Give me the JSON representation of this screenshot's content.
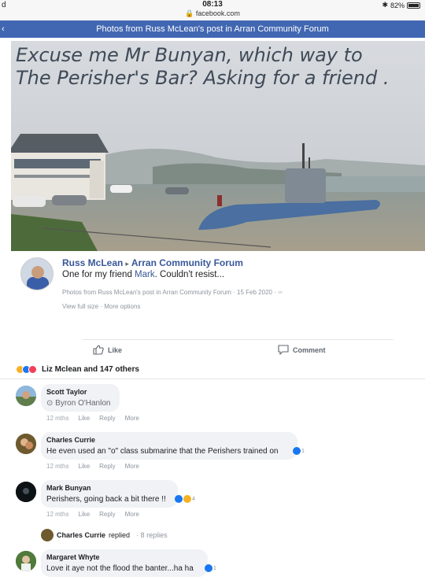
{
  "status_bar": {
    "left": "d",
    "time": "08:13",
    "url": "facebook.com",
    "battery": "82%"
  },
  "header": {
    "back": "‹",
    "title": "Photos from Russ McLean's post in Arran Community Forum"
  },
  "photo": {
    "caption": "Excuse me Mr Bunyan, which way to\nThe Perisher's Bar? Asking for a friend ."
  },
  "post": {
    "author": "Russ McLean",
    "separator": "▸",
    "group": "Arran Community Forum",
    "message_before": "One for my friend ",
    "mention": "Mark",
    "message_after": ". Couldn't resist...",
    "meta": "Photos from Russ McLean's post in Arran Community Forum · 15 Feb 2020 ·",
    "links": "View full size · More options"
  },
  "actions": {
    "like": "Like",
    "comment": "Comment"
  },
  "reactions": {
    "summary": "Liz Mclean and 147 others",
    "colors": [
      "#f7b125",
      "#1877f2",
      "#f33e58"
    ]
  },
  "comments": [
    {
      "name": "Scott Taylor",
      "text": "Byron O'Hanlon",
      "time": "12 mths",
      "like": "Like",
      "reply": "Reply",
      "more": "More",
      "reaction_count": ""
    },
    {
      "name": "Charles Currie",
      "text": "He even used an \"o\" class submarine that the Perishers trained on",
      "time": "12 mths",
      "like": "Like",
      "reply": "Reply",
      "more": "More",
      "reaction_count": "1"
    },
    {
      "name": "Mark Bunyan",
      "text": "Perishers, going back a bit there !!",
      "time": "12 mths",
      "like": "Like",
      "reply": "Reply",
      "more": "More",
      "reaction_count": "4"
    },
    {
      "name": "Margaret Whyte",
      "text": "Love it aye not the flood the banter...ha ha",
      "reaction_count": "1"
    }
  ],
  "reply_thread": {
    "who": "Charles Currie",
    "replied": "replied",
    "count": "· 8 replies"
  }
}
